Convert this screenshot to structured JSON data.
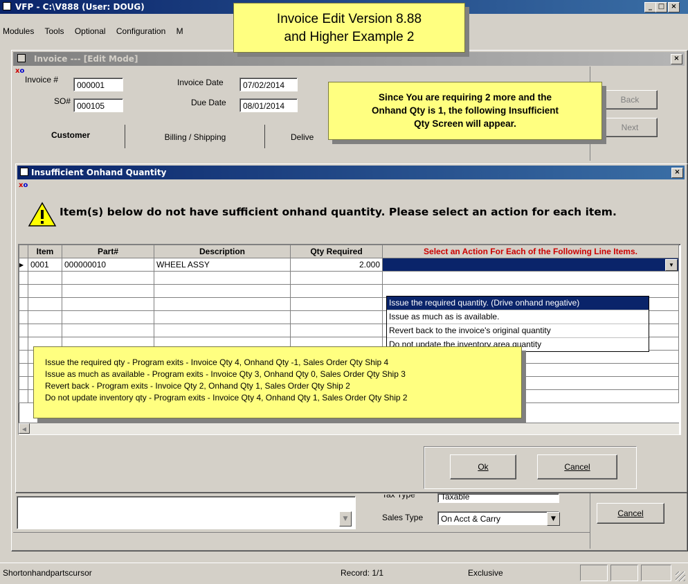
{
  "app": {
    "title": "VFP - C:\\V888  (User: DOUG)",
    "menu": [
      "Modules",
      "Tools",
      "Optional",
      "Configuration",
      "M"
    ],
    "window_controls": [
      "_",
      "□",
      "×"
    ]
  },
  "callout_title": {
    "line1": "Invoice Edit Version 8.88",
    "line2": "and Higher Example 2"
  },
  "invoice": {
    "title": "Invoice --- [Edit Mode]",
    "invoice_no_label": "Invoice #",
    "invoice_no": "000001",
    "so_label": "SO#",
    "so_no": "000105",
    "invoice_date_label": "Invoice Date",
    "invoice_date": "07/02/2014",
    "due_date_label": "Due Date",
    "due_date": "08/01/2014",
    "tabs": [
      "Customer",
      "Billing / Shipping",
      "Delive"
    ],
    "back_label": "Back",
    "next_label": "Next",
    "tax_type_label": "Tax Type",
    "tax_type_value": "Taxable",
    "sales_type_label": "Sales Type",
    "sales_type_value": "On Acct & Carry",
    "cancel_label": "Cancel"
  },
  "callout_info": {
    "line1": "Since You are requiring 2 more and the",
    "line2": "Onhand Qty  is 1, the following Insufficient",
    "line3": "Qty Screen will appear."
  },
  "dialog": {
    "title": "Insufficient Onhand Quantity",
    "message": "Item(s) below do not have sufficient onhand quantity.  Please select an action for each item.",
    "columns": [
      "Item",
      "Part#",
      "Description",
      "Qty Required",
      "Select an Action For Each of the Following Line Items."
    ],
    "row": {
      "item": "0001",
      "part": "000000010",
      "description": "WHEEL ASSY",
      "qty": "2.000",
      "action": ""
    },
    "options": [
      "Issue the required quantity. (Drive onhand negative)",
      "Issue as much as is available.",
      "Revert back to the invoice's original quantity",
      "Do not update the inventory area quantity"
    ],
    "ok_label": "Ok",
    "cancel_label": "Cancel"
  },
  "callout_notes": [
    "Issue the required qty - Program exits - Invoice Qty 4, Onhand Qty -1, Sales Order Qty Ship 4",
    "Issue as much as available - Program exits -  Invoice Qty 3, Onhand Qty 0, Sales Order Qty Ship 3",
    "Revert back - Program exits -  Invoice Qty 2, Onhand Qty 1, Sales Order Qty Ship 2",
    "Do not update inventory qty - Program exits - Invoice Qty 4, Onhand Qty 1, Sales Order Qty Ship 2"
  ],
  "status": {
    "cursor": "Shortonhandpartscursor",
    "record": "Record: 1/1",
    "mode": "Exclusive"
  },
  "colors": {
    "titlebar": "#0a246a",
    "callout": "#ffff80",
    "header_red": "#cc0000",
    "selection": "#0a246a"
  }
}
